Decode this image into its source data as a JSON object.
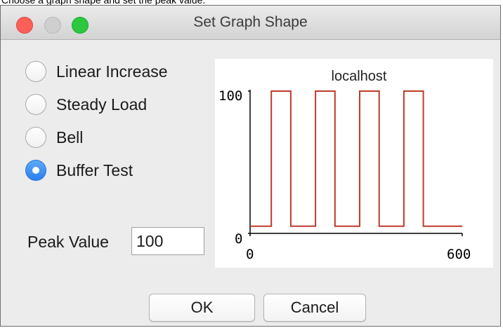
{
  "caption": "Choose a graph shape and set the peak value.",
  "window": {
    "title": "Set Graph Shape"
  },
  "shapes": [
    {
      "label": "Linear Increase",
      "checked": false
    },
    {
      "label": "Steady Load",
      "checked": false
    },
    {
      "label": "Bell",
      "checked": false
    },
    {
      "label": "Buffer Test",
      "checked": true
    }
  ],
  "peak": {
    "label": "Peak Value",
    "value": "100"
  },
  "buttons": {
    "ok": "OK",
    "cancel": "Cancel"
  },
  "chart_data": {
    "type": "line",
    "title": "localhost",
    "xlabel": "",
    "ylabel": "",
    "xlim": [
      0,
      600
    ],
    "ylim": [
      0,
      100
    ],
    "x_ticks": [
      "0",
      "600"
    ],
    "y_ticks": [
      "0",
      "100"
    ],
    "grid": false,
    "line_color": "#c0392b",
    "series": [
      {
        "x": [
          0,
          60,
          60,
          115,
          115,
          185,
          185,
          240,
          240,
          310,
          310,
          365,
          365,
          435,
          435,
          490,
          490,
          600
        ],
        "y": [
          5,
          5,
          100,
          100,
          5,
          5,
          100,
          100,
          5,
          5,
          100,
          100,
          5,
          5,
          100,
          100,
          5,
          5
        ]
      }
    ]
  },
  "colors": {
    "accent": "#2b7ff0",
    "close": "#fc5f57",
    "minimize": "#cfcfcf",
    "zoom": "#2bc840"
  }
}
